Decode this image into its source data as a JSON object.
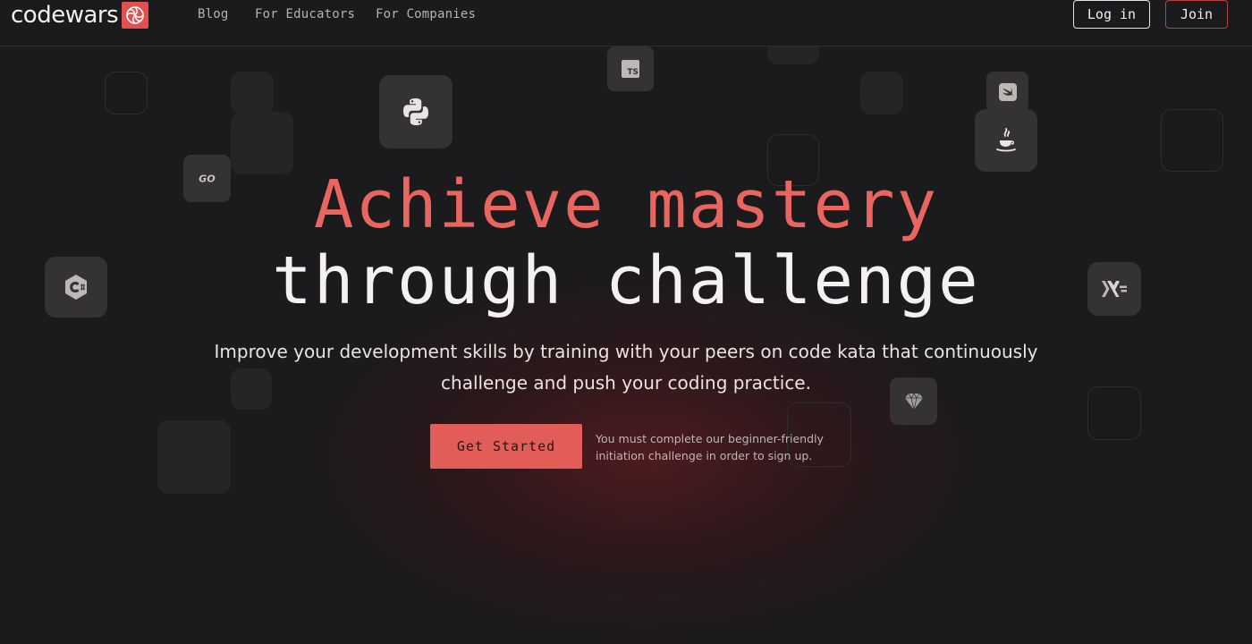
{
  "brand": {
    "name": "codewars"
  },
  "nav": {
    "links": [
      "Blog",
      "For Educators",
      "For Companies"
    ],
    "login_label": "Log in",
    "join_label": "Join"
  },
  "hero": {
    "title_line1": "Achieve mastery",
    "title_line2": "through challenge",
    "subtitle_line1": "Improve your development skills by training with your peers on code kata that continuously",
    "subtitle_line2": "challenge and push your coding practice.",
    "cta_label": "Get Started",
    "cta_note_line1": "You must complete our beginner-friendly",
    "cta_note_line2": "initiation challenge in order to sign up."
  },
  "language_tiles": {
    "icons": [
      "python-icon",
      "typescript-icon",
      "go-icon",
      "swift-icon",
      "java-icon",
      "csharp-icon",
      "haskell-icon",
      "ruby-icon"
    ],
    "ts_label": "TS",
    "go_label": "GO"
  },
  "colors": {
    "accent": "#e35d58",
    "background": "#1b1a1c",
    "tile": "#343235"
  }
}
